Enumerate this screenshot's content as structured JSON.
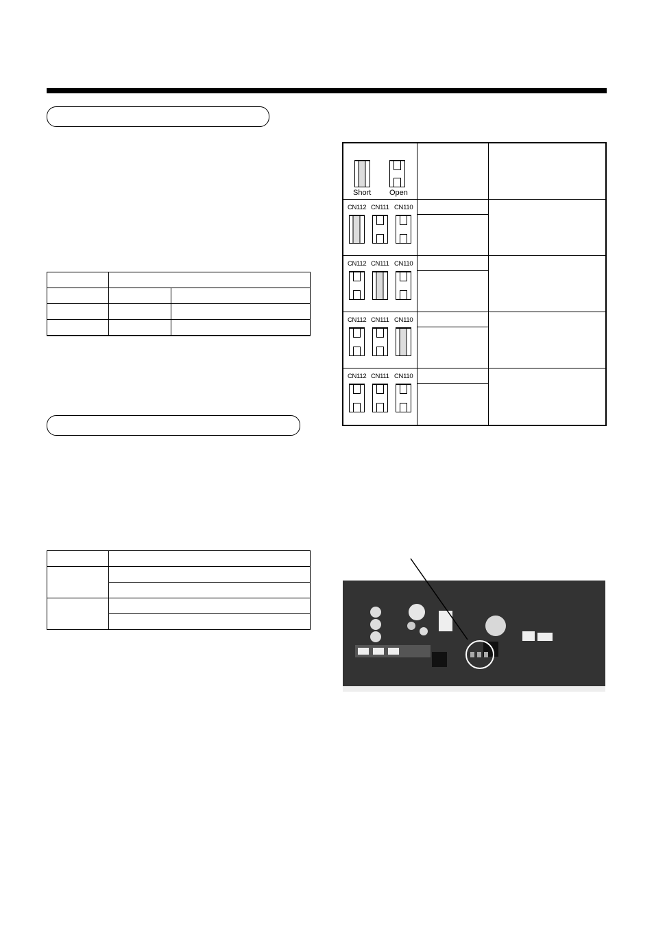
{
  "section1": {
    "title": ""
  },
  "section2": {
    "title": ""
  },
  "table1": {
    "header": [
      "",
      ""
    ],
    "rows": [
      [
        "",
        "",
        ""
      ],
      [
        "",
        "",
        ""
      ],
      [
        "",
        "",
        ""
      ]
    ]
  },
  "table2": {
    "header": [
      "",
      ""
    ],
    "groups": [
      {
        "label": "",
        "rows": [
          "",
          ""
        ]
      },
      {
        "label": "",
        "rows": [
          "",
          ""
        ]
      }
    ]
  },
  "jumper_table": {
    "legend": {
      "short_label": "Short",
      "open_label": "Open"
    },
    "connector_labels": [
      "CN112",
      "CN111",
      "CN110"
    ],
    "settings": [
      {
        "states": [
          "short",
          "open",
          "open"
        ]
      },
      {
        "states": [
          "open",
          "short",
          "open"
        ]
      },
      {
        "states": [
          "open",
          "open",
          "short"
        ]
      },
      {
        "states": [
          "open",
          "open",
          "open"
        ]
      }
    ]
  },
  "photo": {
    "description": "Circuit board photo with jumper location circled"
  }
}
